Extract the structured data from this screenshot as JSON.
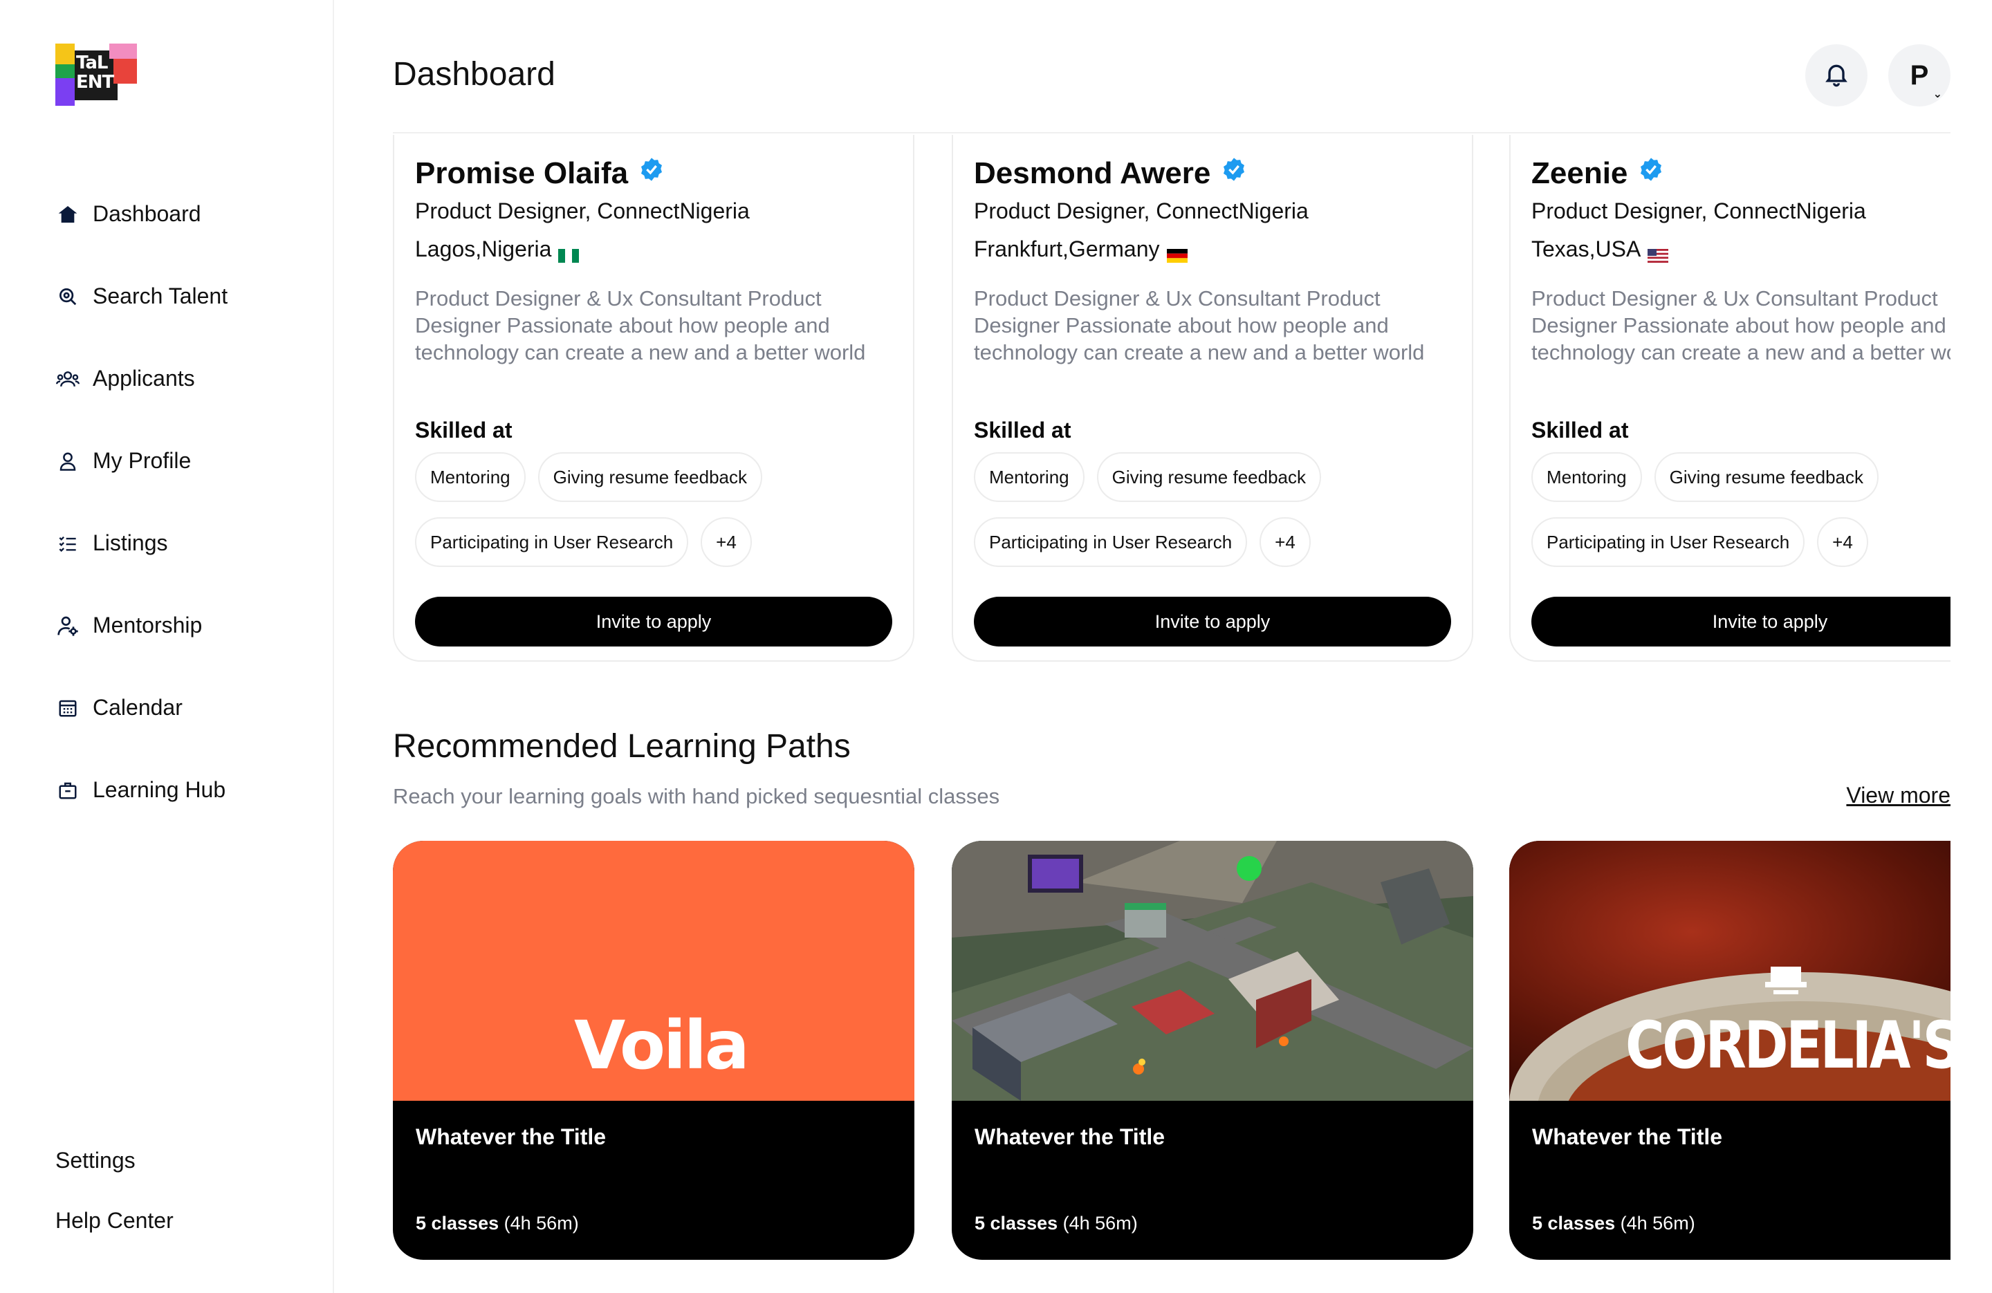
{
  "app": {
    "logo_text_line1": "TaL",
    "logo_text_line2": "ENT"
  },
  "sidebar": {
    "items": [
      {
        "label": "Dashboard",
        "icon": "home-icon",
        "active": true
      },
      {
        "label": "Search Talent",
        "icon": "search-icon"
      },
      {
        "label": "Applicants",
        "icon": "users-icon"
      },
      {
        "label": "My Profile",
        "icon": "user-icon"
      },
      {
        "label": "Listings",
        "icon": "checklist-icon"
      },
      {
        "label": "Mentorship",
        "icon": "mentor-icon"
      },
      {
        "label": "Calendar",
        "icon": "calendar-icon"
      },
      {
        "label": "Learning Hub",
        "icon": "briefcase-icon"
      }
    ],
    "bottom": [
      {
        "label": "Settings"
      },
      {
        "label": "Help Center"
      }
    ]
  },
  "header": {
    "title": "Dashboard",
    "avatar_initial": "P"
  },
  "talents": [
    {
      "name": "Promise Olaifa",
      "role": "Product Designer, ConnectNigeria",
      "location": "Lagos,Nigeria",
      "flag": "nigeria",
      "bio": "Product Designer & Ux Consultant Product Designer Passionate about how people and technology can create a new and a better world",
      "skilled_label": "Skilled at",
      "skills": [
        "Mentoring",
        "Giving resume feedback",
        "Participating in User Research",
        "+4"
      ],
      "cta": "Invite to apply"
    },
    {
      "name": "Desmond Awere",
      "role": "Product Designer, ConnectNigeria",
      "location": "Frankfurt,Germany",
      "flag": "germany",
      "bio": "Product Designer & Ux Consultant Product Designer Passionate about how people and technology can create a new and a better world",
      "skilled_label": "Skilled at",
      "skills": [
        "Mentoring",
        "Giving resume feedback",
        "Participating in User Research",
        "+4"
      ],
      "cta": "Invite to apply"
    },
    {
      "name": "Zeenie",
      "role": "Product Designer, ConnectNigeria",
      "location": "Texas,USA",
      "flag": "usa",
      "bio": "Product Designer & Ux Consultant Product Designer Passionate about how people and technology can create a new and a better world",
      "skilled_label": "Skilled at",
      "skills": [
        "Mentoring",
        "Giving resume feedback",
        "Participating in User Research",
        "+4"
      ],
      "cta": "Invite to apply"
    }
  ],
  "learning": {
    "title": "Recommended Learning Paths",
    "subtitle": "Reach your learning goals with hand picked sequesntial classes",
    "view_more": "View more",
    "cards": [
      {
        "image_text": "Voila",
        "title": "Whatever the Title",
        "classes": "5 classes",
        "duration": "(4h 56m)"
      },
      {
        "image_text": "",
        "title": "Whatever the Title",
        "classes": "5 classes",
        "duration": "(4h 56m)"
      },
      {
        "image_text": "CORDELIA'S",
        "title": "Whatever the Title",
        "classes": "5 classes",
        "duration": "(4h 56m)"
      }
    ]
  },
  "colors": {
    "accent_orange": "#ff6a3d",
    "verified_blue": "#1d9bf0",
    "muted_text": "#7b7f8a",
    "cta_black": "#000000"
  }
}
